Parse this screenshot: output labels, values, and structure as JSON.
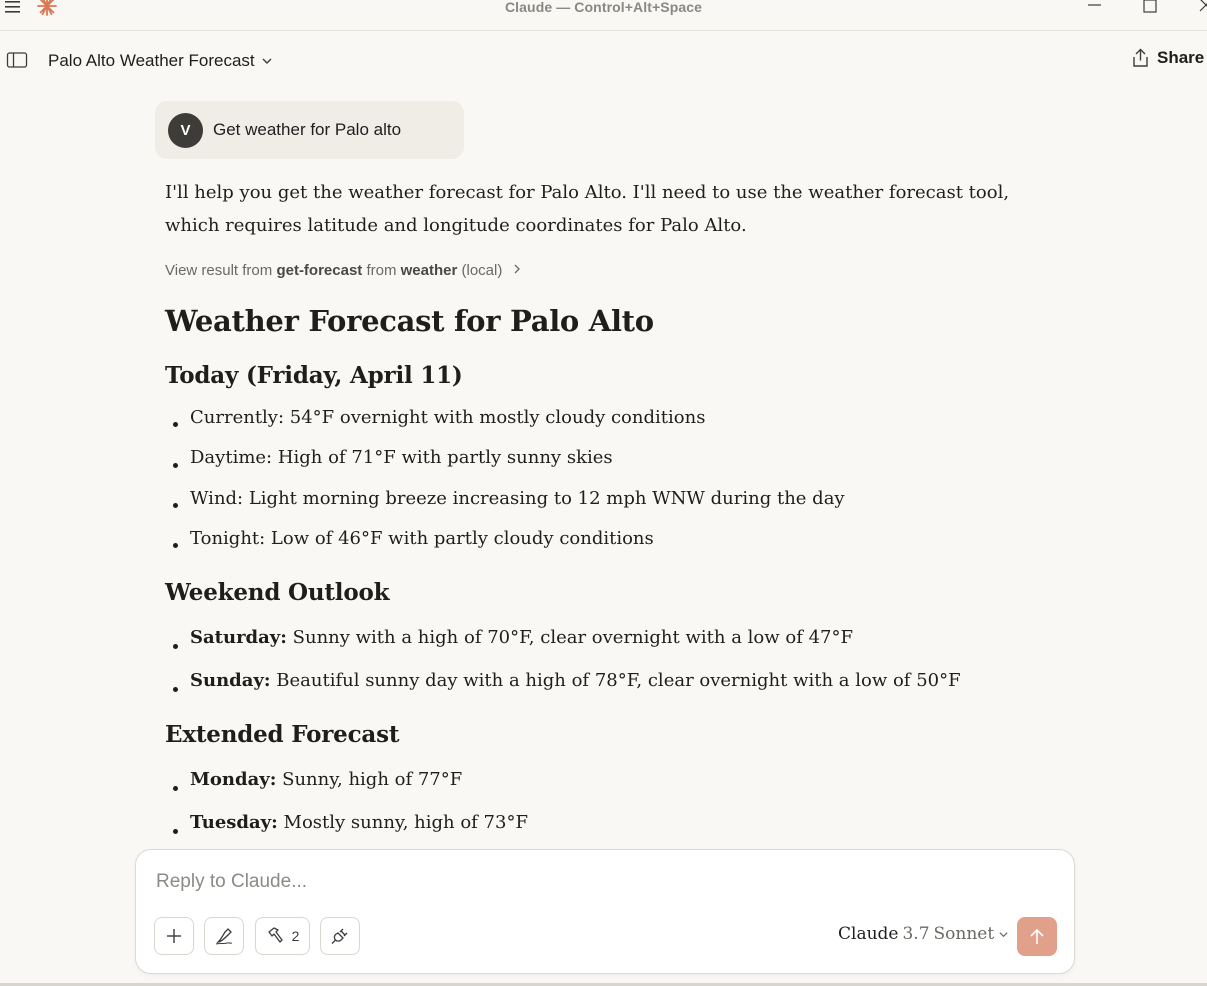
{
  "window": {
    "title": "Claude — Control+Alt+Space"
  },
  "header": {
    "conversation_title": "Palo Alto Weather Forecast",
    "share_label": "Share"
  },
  "user_message": {
    "avatar_initial": "V",
    "text": "Get weather for Palo alto"
  },
  "answer": {
    "intro": "I'll help you get the weather forecast for Palo Alto. I'll need to use the weather forecast tool, which requires latitude and longitude coordinates for Palo Alto.",
    "tool_result": {
      "prefix": "View result from",
      "tool": "get-forecast",
      "middle": "from",
      "server": "weather",
      "suffix": "(local)"
    },
    "heading": "Weather Forecast for Palo Alto",
    "sections": [
      {
        "title": "Today (Friday, April 11)",
        "items": [
          {
            "label": "",
            "text": "Currently: 54°F overnight with mostly cloudy conditions"
          },
          {
            "label": "",
            "text": "Daytime: High of 71°F with partly sunny skies"
          },
          {
            "label": "",
            "text": "Wind: Light morning breeze increasing to 12 mph WNW during the day"
          },
          {
            "label": "",
            "text": "Tonight: Low of 46°F with partly cloudy conditions"
          }
        ]
      },
      {
        "title": "Weekend Outlook",
        "items": [
          {
            "label": "Saturday:",
            "text": "Sunny with a high of 70°F, clear overnight with a low of 47°F"
          },
          {
            "label": "Sunday:",
            "text": "Beautiful sunny day with a high of 78°F, clear overnight with a low of 50°F"
          }
        ]
      },
      {
        "title": "Extended Forecast",
        "items": [
          {
            "label": "Monday:",
            "text": "Sunny, high of 77°F"
          },
          {
            "label": "Tuesday:",
            "text": "Mostly sunny, high of 73°F"
          }
        ]
      }
    ]
  },
  "composer": {
    "placeholder": "Reply to Claude...",
    "tools_count": "2",
    "model_brand": "Claude",
    "model_version": "3.7",
    "model_name": "Sonnet"
  },
  "colors": {
    "background": "#f9f8f5",
    "accent_logo": "#d97757",
    "send_button": "#e0a08a",
    "user_bubble": "#efede6"
  },
  "icons": {
    "menu": "hamburger-icon",
    "logo": "claude-asterisk-icon",
    "sidebar": "sidebar-toggle-icon",
    "share": "share-icon",
    "plus": "plus-icon",
    "style": "pen-style-icon",
    "tools": "hammer-icon",
    "integrations": "plug-icon",
    "send": "arrow-up-icon"
  }
}
